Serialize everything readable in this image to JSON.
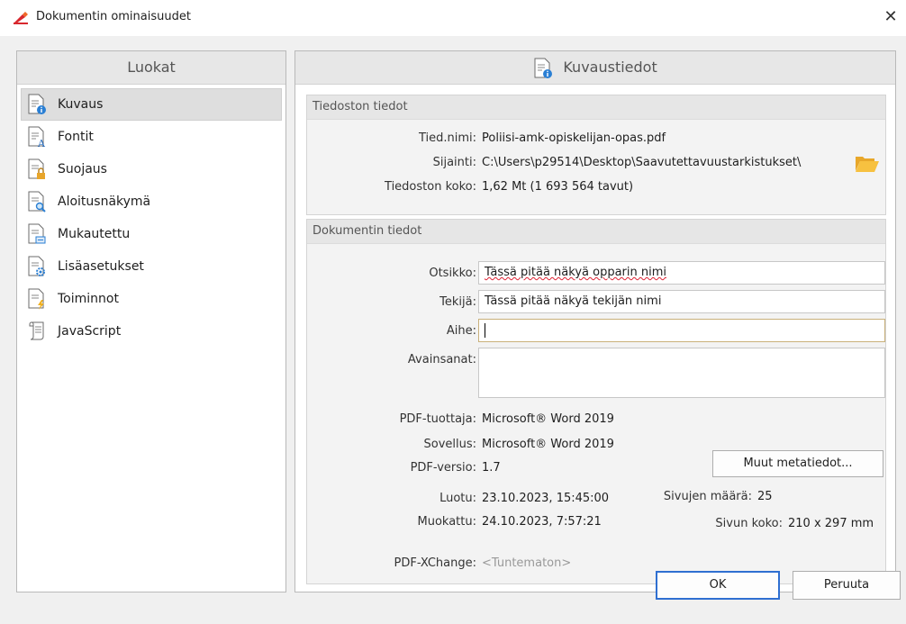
{
  "window": {
    "title": "Dokumentin ominaisuudet",
    "close_glyph": "✕"
  },
  "categories": {
    "header": "Luokat",
    "items": [
      {
        "label": "Kuvaus",
        "icon": "doc-info-icon",
        "selected": true
      },
      {
        "label": "Fontit",
        "icon": "doc-font-icon"
      },
      {
        "label": "Suojaus",
        "icon": "doc-lock-icon"
      },
      {
        "label": "Aloitusnäkymä",
        "icon": "doc-search-icon"
      },
      {
        "label": "Mukautettu",
        "icon": "doc-custom-icon"
      },
      {
        "label": "Lisäasetukset",
        "icon": "doc-gear-icon"
      },
      {
        "label": "Toiminnot",
        "icon": "doc-lightning-icon"
      },
      {
        "label": "JavaScript",
        "icon": "script-scroll-icon"
      }
    ]
  },
  "description": {
    "header": "Kuvaustiedot",
    "file_info": {
      "title": "Tiedoston tiedot",
      "filename_label": "Tied.nimi:",
      "filename": "Poliisi-amk-opiskelijan-opas.pdf",
      "location_label": "Sijainti:",
      "location": "C:\\Users\\p29514\\Desktop\\Saavutettavuustarkistukset\\",
      "size_label": "Tiedoston koko:",
      "size": "1,62 Mt (1 693 564 tavut)"
    },
    "doc_info": {
      "title": "Dokumentin tiedot",
      "title_label": "Otsikko:",
      "title_value": "Tässä pitää näkyä opparin nimi",
      "author_label": "Tekijä:",
      "author_value": "Tässä pitää näkyä tekijän nimi",
      "subject_label": "Aihe:",
      "subject_value": "",
      "keywords_label": "Avainsanat:",
      "keywords_value": "",
      "producer_label": "PDF-tuottaja:",
      "producer": "Microsoft® Word 2019",
      "application_label": "Sovellus:",
      "application": "Microsoft® Word 2019",
      "version_label": "PDF-versio:",
      "version": "1.7",
      "created_label": "Luotu:",
      "created": "23.10.2023, 15:45:00",
      "modified_label": "Muokattu:",
      "modified": "24.10.2023, 7:57:21",
      "pages_label": "Sivujen määrä:",
      "pages": "25",
      "page_size_label": "Sivun koko:",
      "page_size": "210 x 297 mm",
      "xchange_label": "PDF-XChange:",
      "xchange": "<Tuntematon>",
      "more_metadata_button": "Muut metatiedot..."
    }
  },
  "footer": {
    "ok": "OK",
    "cancel": "Peruuta"
  },
  "colors": {
    "folder": "#f7c140",
    "ok_border": "#2f6fd1",
    "app_icon": "#d8282e"
  }
}
